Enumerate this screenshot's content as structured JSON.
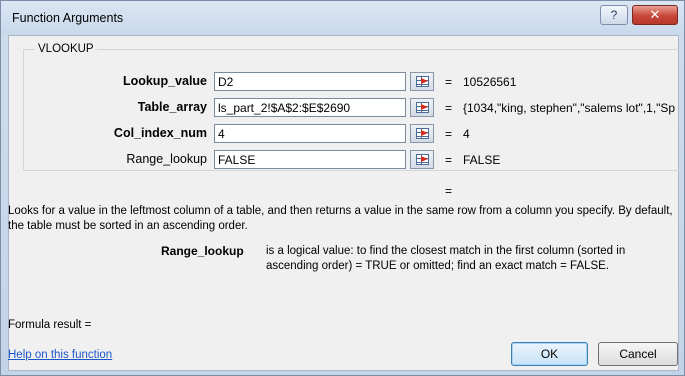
{
  "window": {
    "title": "Function Arguments",
    "help_glyph": "?",
    "close_glyph": "✕"
  },
  "function_name": "VLOOKUP",
  "arguments": [
    {
      "label": "Lookup_value",
      "value": "D2",
      "result": "10526561",
      "bold": true
    },
    {
      "label": "Table_array",
      "value": "ls_part_2!$A$2:$E$2690",
      "result": "{1034,\"king, stephen\",\"salems lot\",1,\"Sp",
      "bold": true
    },
    {
      "label": "Col_index_num",
      "value": "4",
      "result": "4",
      "bold": true
    },
    {
      "label": "Range_lookup",
      "value": "FALSE",
      "result": "FALSE",
      "bold": false
    }
  ],
  "equals_sign": "=",
  "description": "Looks for a value in the leftmost column of a table, and then returns a value in the same row from a column you specify. By default, the table must be sorted in an ascending order.",
  "arg_help": {
    "label": "Range_lookup",
    "text": "is a logical value: to find the closest match in the first column (sorted in ascending order) = TRUE or omitted; find an exact match = FALSE."
  },
  "formula_result": "Formula result =",
  "help_link": "Help on this function",
  "buttons": {
    "ok": "OK",
    "cancel": "Cancel"
  },
  "icons": {
    "collapse": "collapse-dialog-icon"
  }
}
